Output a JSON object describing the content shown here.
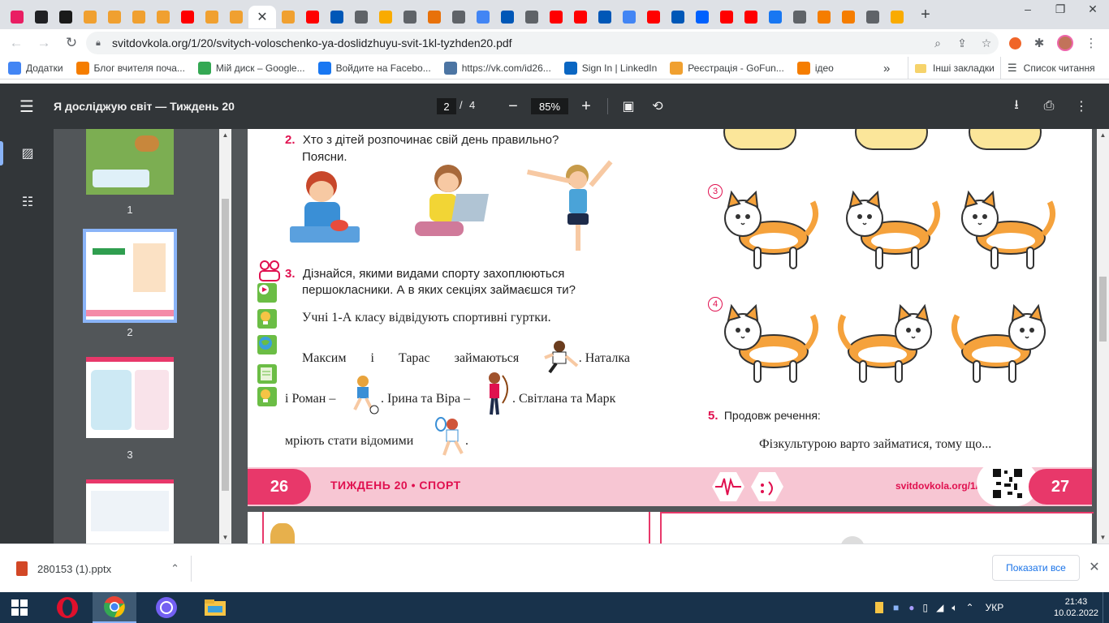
{
  "browser": {
    "tabs": [
      {
        "icon": "puzzle-pink-icon",
        "color": "#e91e63"
      },
      {
        "icon": "bookmark-icon",
        "color": "#202124"
      },
      {
        "icon": "h-icon",
        "color": "#1a1a1a"
      },
      {
        "icon": "ok-icon",
        "color": "#f0a030"
      },
      {
        "icon": "ok-icon",
        "color": "#f0a030"
      },
      {
        "icon": "ok-icon",
        "color": "#f0a030"
      },
      {
        "icon": "ok-icon",
        "color": "#f0a030"
      },
      {
        "icon": "youtube-icon",
        "color": "#ff0000"
      },
      {
        "icon": "ok-icon",
        "color": "#f0a030"
      },
      {
        "icon": "ok-icon",
        "color": "#f0a030"
      },
      {
        "icon": "active-tab",
        "color": "#ffffff"
      },
      {
        "icon": "ok-icon",
        "color": "#f0a030"
      },
      {
        "icon": "youtube-icon",
        "color": "#ff0000"
      },
      {
        "icon": "trident-icon",
        "color": "#0057b7"
      },
      {
        "icon": "globe-icon",
        "color": "#5f6368"
      },
      {
        "icon": "bell-icon",
        "color": "#f9ab00"
      },
      {
        "icon": "globe-icon",
        "color": "#5f6368"
      },
      {
        "icon": "a-icon",
        "color": "#e8710a"
      },
      {
        "icon": "globe-icon",
        "color": "#5f6368"
      },
      {
        "icon": "docs-icon",
        "color": "#4285f4"
      },
      {
        "icon": "trident-icon",
        "color": "#0057b7"
      },
      {
        "icon": "globe-icon",
        "color": "#5f6368"
      },
      {
        "icon": "youtube-icon",
        "color": "#ff0000"
      },
      {
        "icon": "youtube-icon",
        "color": "#ff0000"
      },
      {
        "icon": "trident-icon",
        "color": "#0057b7"
      },
      {
        "icon": "google-icon",
        "color": "#4285f4"
      },
      {
        "icon": "youtube-icon",
        "color": "#ff0000"
      },
      {
        "icon": "trident-icon",
        "color": "#0057b7"
      },
      {
        "icon": "dropbox-icon",
        "color": "#0061fe"
      },
      {
        "icon": "youtube-icon",
        "color": "#ff0000"
      },
      {
        "icon": "youtube-icon",
        "color": "#ff0000"
      },
      {
        "icon": "facebook-icon",
        "color": "#1877f2"
      },
      {
        "icon": "globe-icon",
        "color": "#5f6368"
      },
      {
        "icon": "blogger-icon",
        "color": "#f57d00"
      },
      {
        "icon": "blogger-icon",
        "color": "#f57d00"
      },
      {
        "icon": "globe-icon",
        "color": "#5f6368"
      },
      {
        "icon": "bell-icon",
        "color": "#f9ab00"
      }
    ],
    "url": "svitdovkola.org/1/20/svitych-voloschenko-ya-doslidzhuyu-svit-1kl-tyzhden20.pdf"
  },
  "bookmarks": [
    {
      "label": "Додатки",
      "icon": "apps-grid-icon",
      "color": "#4285f4"
    },
    {
      "label": "Блог вчителя поча...",
      "icon": "blogger-icon",
      "color": "#f57d00"
    },
    {
      "label": "Мій диск – Google...",
      "icon": "drive-icon",
      "color": "#34a853"
    },
    {
      "label": "Войдите на Facebo...",
      "icon": "facebook-icon",
      "color": "#1877f2"
    },
    {
      "label": "https://vk.com/id26...",
      "icon": "vk-icon",
      "color": "#4c75a3"
    },
    {
      "label": "Sign In | LinkedIn",
      "icon": "linkedin-icon",
      "color": "#0a66c2"
    },
    {
      "label": "Реєстрація - GoFun...",
      "icon": "gofun-icon",
      "color": "#f0a030"
    },
    {
      "label": "ідео",
      "icon": "blogger-icon",
      "color": "#f57d00"
    }
  ],
  "bookmarks_more": "»",
  "bookmarks_other": "Інші закладки",
  "reading_list": "Список читання",
  "pdf": {
    "title": "Я досліджую світ — Тиждень 20",
    "page_current": "2",
    "page_sep": "/",
    "page_total": "4",
    "zoom": "85%",
    "thumb_labels": [
      "1",
      "2",
      "3"
    ]
  },
  "page": {
    "q2_num": "2.",
    "q2_line1": "Хто з дітей розпочинає свій день правильно?",
    "q2_line2": "Поясни.",
    "q3_num": "3.",
    "q3_line1": "Дізнайся, якими видами спорту захоплюються",
    "q3_line2": "першокласники. А в яких секціях займаєшся ти?",
    "p1": "Учні 1-А класу відвідують спортивні гуртки.",
    "p2a": "Максим і Тарас займаються",
    "p2b": ". Наталка",
    "p3a": "і Роман –",
    "p3b": ". Ірина та Віра –",
    "p3c": ". Світлана та Марк",
    "p4": "мріють стати відомими",
    "p4end": ".",
    "num3": "3",
    "num4": "4",
    "q5_num": "5.",
    "q5_text": "Продовж речення:",
    "q5_sentence": "Фізкультурою варто займатися, тому що...",
    "footer_left_num": "26",
    "footer_title": "ТИЖДЕНЬ 20 • СПОРТ",
    "footer_site": "svitdovkola.org/1/20",
    "footer_right_num": "27"
  },
  "downloads": {
    "file": "280153 (1).pptx",
    "show_all": "Показати все"
  },
  "taskbar": {
    "lang": "УКР",
    "time": "21:43",
    "date": "10.02.2022"
  }
}
